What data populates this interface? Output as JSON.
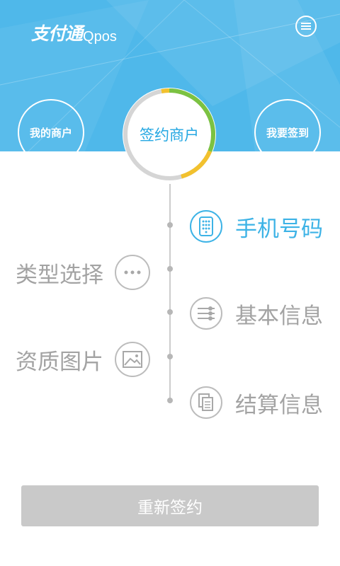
{
  "header": {
    "logo_cn": "支付通",
    "logo_en": "Qpos",
    "menu_icon": "menu-icon",
    "bg_color": "#4fb8ea"
  },
  "tabs": {
    "left": "我的商户",
    "center": "签约商户",
    "right": "我要签到"
  },
  "steps": [
    {
      "label": "手机号码",
      "icon": "phone-keypad-icon",
      "side": "right",
      "active": true
    },
    {
      "label": "类型选择",
      "icon": "more-dots-icon",
      "side": "left",
      "active": false
    },
    {
      "label": "基本信息",
      "icon": "list-icon",
      "side": "right",
      "active": false
    },
    {
      "label": "资质图片",
      "icon": "image-icon",
      "side": "left",
      "active": false
    },
    {
      "label": "结算信息",
      "icon": "document-icon",
      "side": "right",
      "active": false
    }
  ],
  "button": {
    "label": "重新签约"
  },
  "colors": {
    "accent": "#3db3e6",
    "ring_green": "#7cc242",
    "ring_yellow": "#f2c12e",
    "inactive": "#a3a3a3",
    "button_bg": "#c9c9c9"
  }
}
